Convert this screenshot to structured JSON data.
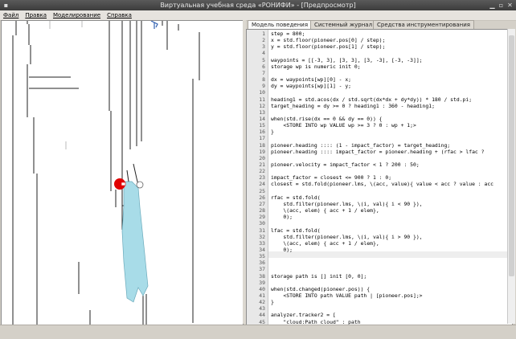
{
  "window": {
    "title": "Виртуальная учебная среда «РОНИФИ» - [Предпросмотр]"
  },
  "menu": [
    "Файл",
    "Правка",
    "Моделирование",
    "Справка"
  ],
  "tabs": [
    {
      "label": "Модель поведения",
      "active": true
    },
    {
      "label": "Системный журнал",
      "active": false
    },
    {
      "label": "Средства инструментирования",
      "active": false
    }
  ],
  "editor": {
    "line_numbers": [
      "1",
      "2",
      "3",
      "4",
      "5",
      "6",
      "7",
      "8",
      "9",
      "10",
      "11",
      "12",
      "13",
      "14",
      "15",
      "16",
      "17",
      "18",
      "19",
      "20",
      "21",
      "22",
      "23",
      "24",
      "25",
      "26",
      "27",
      "28",
      "29",
      "30",
      "31",
      "32",
      "33",
      "34",
      "35",
      "36",
      "37",
      "38",
      "39",
      "40",
      "41",
      "42",
      "43",
      "44",
      "45"
    ],
    "lines": [
      "step = 800;",
      "x = std.floor(pioneer.pos[0] / step);",
      "y = std.floor(pioneer.pos[1] / step);",
      "",
      "waypoints = [[-3, 3], [3, 3], [3, -3], [-3, -3]];",
      "storage wp is numeric init 0;",
      "",
      "dx = waypoints[wp][0] - x;",
      "dy = waypoints[wp][1] - y;",
      "",
      "heading1 = std.acos(dx / std.sqrt(dx*dx + dy*dy)) * 180 / std.pi;",
      "target_heading = dy >= 0 ? heading1 : 360 - heading1;",
      "",
      "when(std.rise(dx == 0 && dy == 0)) {",
      "    <STORE INTO wp VALUE wp >= 3 ? 0 : wp + 1;>",
      "}",
      "",
      "pioneer.heading :::: (1 - impact_factor) = target_heading;",
      "pioneer.heading :::: impact_factor = pioneer.heading + (rfac > lfac ?",
      "",
      "pioneer.velocity = impact_factor < 1 ? 200 : 50;",
      "",
      "impact_factor = closest <= 900 ? 1 : 0;",
      "closest = std.fold(pioneer.lms, \\(acc, value){ value < acc ? value : acc",
      "",
      "rfac = std.fold(",
      "    std.filter(pioneer.lms, \\(i, val){ i < 90 }),",
      "    \\(acc, elem) { acc + 1 / elem},",
      "    0);",
      "",
      "lfac = std.fold(",
      "    std.filter(pioneer.lms, \\(i, val){ i > 90 }),",
      "    \\(acc, elem) { acc + 1 / elem},",
      "    0);",
      "",
      "",
      "",
      "storage path is [] init [0, 0];",
      "",
      "when(std.changed(pioneer.pos)) {",
      "    <STORE INTO path VALUE path | [pioneer.pos];>",
      "}",
      "",
      "analyzer.tracker2 = [",
      "    \"cloud:Path cloud\" : path"
    ]
  },
  "colors": {
    "robot": "#e00000",
    "scan_area": "#a8dce8"
  }
}
